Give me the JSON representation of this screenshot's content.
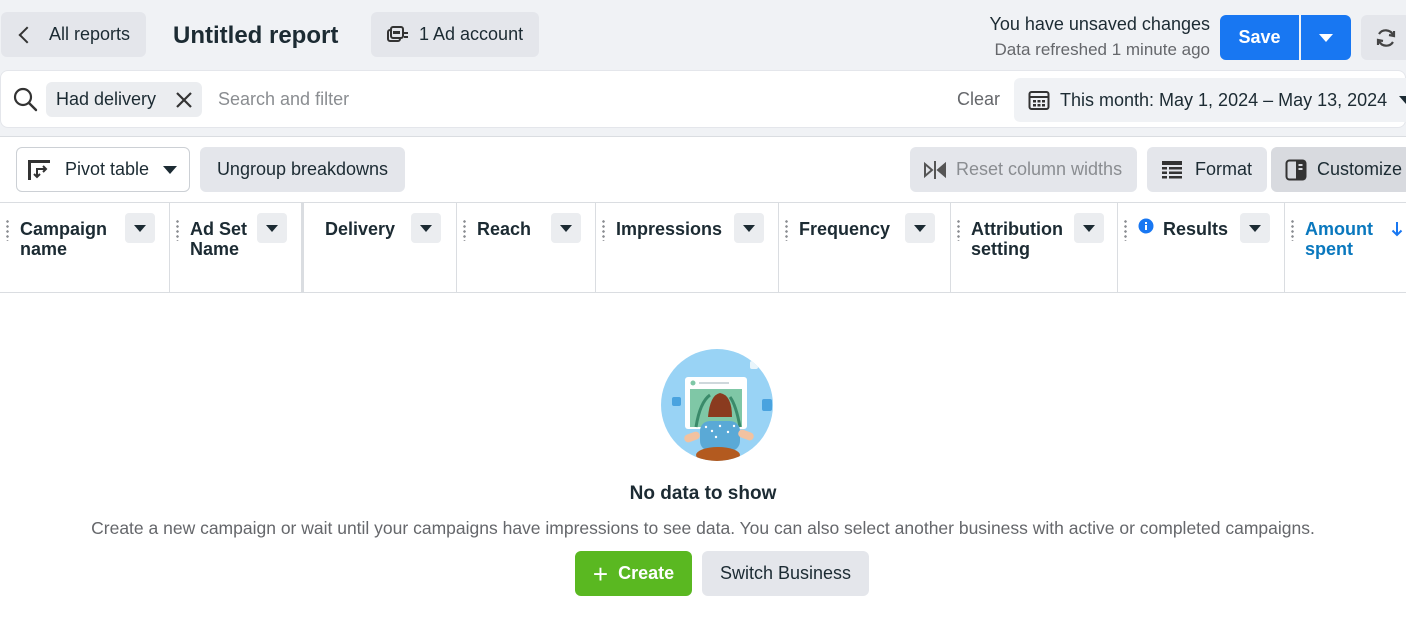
{
  "header": {
    "back_label": "All reports",
    "report_title": "Untitled report",
    "ad_account_label": "1 Ad account",
    "unsaved_text": "You have unsaved changes",
    "refreshed_text": "Data refreshed 1 minute ago",
    "save_label": "Save"
  },
  "filter_bar": {
    "chip_label": "Had delivery",
    "search_placeholder": "Search and filter",
    "clear_label": "Clear",
    "date_range_label": "This month: May 1, 2024 – May 13, 2024"
  },
  "toolbar": {
    "pivot_label": "Pivot table",
    "ungroup_label": "Ungroup breakdowns",
    "reset_widths_label": "Reset column widths",
    "format_label": "Format",
    "customize_label": "Customize"
  },
  "table": {
    "columns": [
      {
        "line1": "Campaign",
        "line2": "name"
      },
      {
        "line1": "Ad Set",
        "line2": "Name"
      },
      {
        "line1": "Delivery",
        "line2": ""
      },
      {
        "line1": "Reach",
        "line2": ""
      },
      {
        "line1": "Impressions",
        "line2": ""
      },
      {
        "line1": "Frequency",
        "line2": ""
      },
      {
        "line1": "Attribution",
        "line2": "setting"
      },
      {
        "line1": "Results",
        "line2": ""
      },
      {
        "line1": "Amount",
        "line2": "spent"
      }
    ],
    "sorted_column_color": "#0a78be"
  },
  "empty_state": {
    "title": "No data to show",
    "description": "Create a new campaign or wait until your campaigns have impressions to see data. You can also select another business with active or completed campaigns.",
    "create_label": "Create",
    "switch_label": "Switch Business"
  },
  "colors": {
    "primary": "#1877f2",
    "create_green": "#5ab821"
  }
}
